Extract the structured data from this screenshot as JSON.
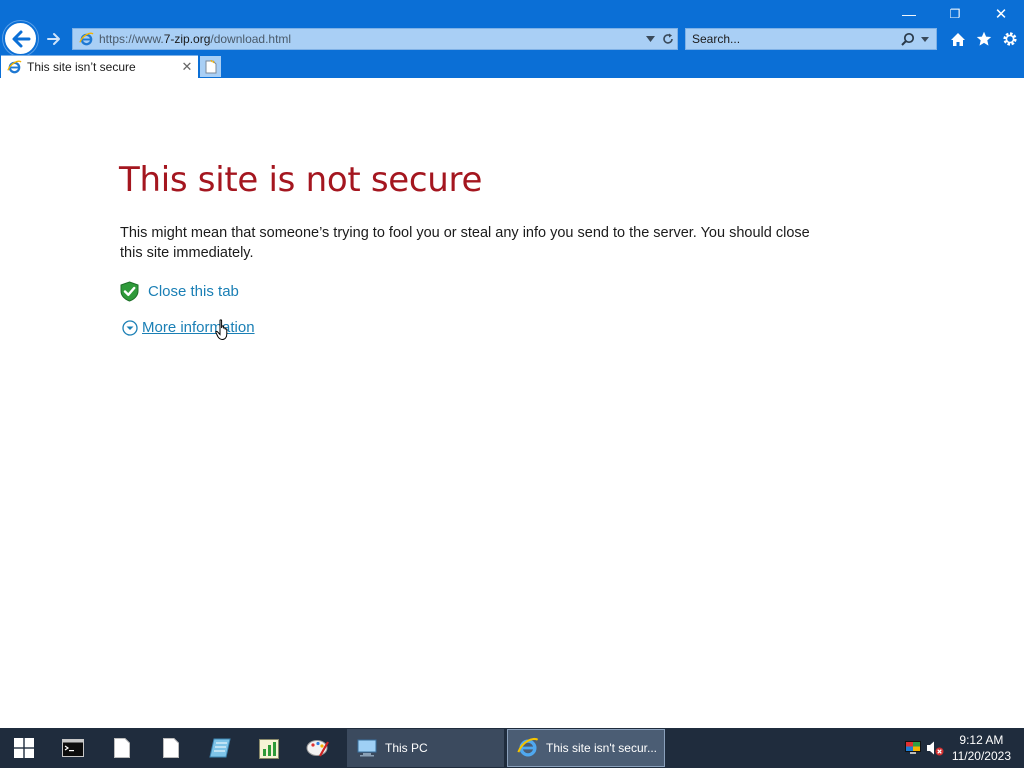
{
  "window": {
    "minimize_glyph": "—",
    "restore_glyph": "❐",
    "close_glyph": "✕"
  },
  "toolbar": {
    "back_icon": "back-arrow-icon",
    "forward_icon": "forward-arrow-icon",
    "address": {
      "prefix": "https://www.",
      "domain": "7-zip.org",
      "path": "/download.html"
    },
    "search_placeholder": "Search...",
    "tools": [
      "home-icon",
      "favorites-star-icon",
      "settings-gear-icon"
    ]
  },
  "tabs": [
    {
      "title": "This site isn’t secure",
      "close_glyph": "✕"
    }
  ],
  "page": {
    "title": "This site is not secure",
    "description": "This might mean that someone’s trying to fool you or steal any info you send to the server. You should close this site immediately.",
    "close_tab_label": "Close this tab",
    "more_info_label": "More information"
  },
  "taskbar": {
    "pinned": [
      "command-prompt-icon",
      "file-icon",
      "file-icon",
      "notepad-icon",
      "spreadsheet-icon",
      "paint-icon"
    ],
    "windows": [
      {
        "label": "This PC",
        "icon": "computer-icon"
      },
      {
        "label": "This site isn't secur...",
        "icon": "internet-explorer-icon"
      }
    ],
    "clock": {
      "time": "9:12 AM",
      "date": "11/20/2023"
    }
  },
  "colors": {
    "chrome": "#0b6fd6",
    "title_red": "#a4161f",
    "link_blue": "#1a7fb5",
    "taskbar": "#1f2c3d"
  }
}
